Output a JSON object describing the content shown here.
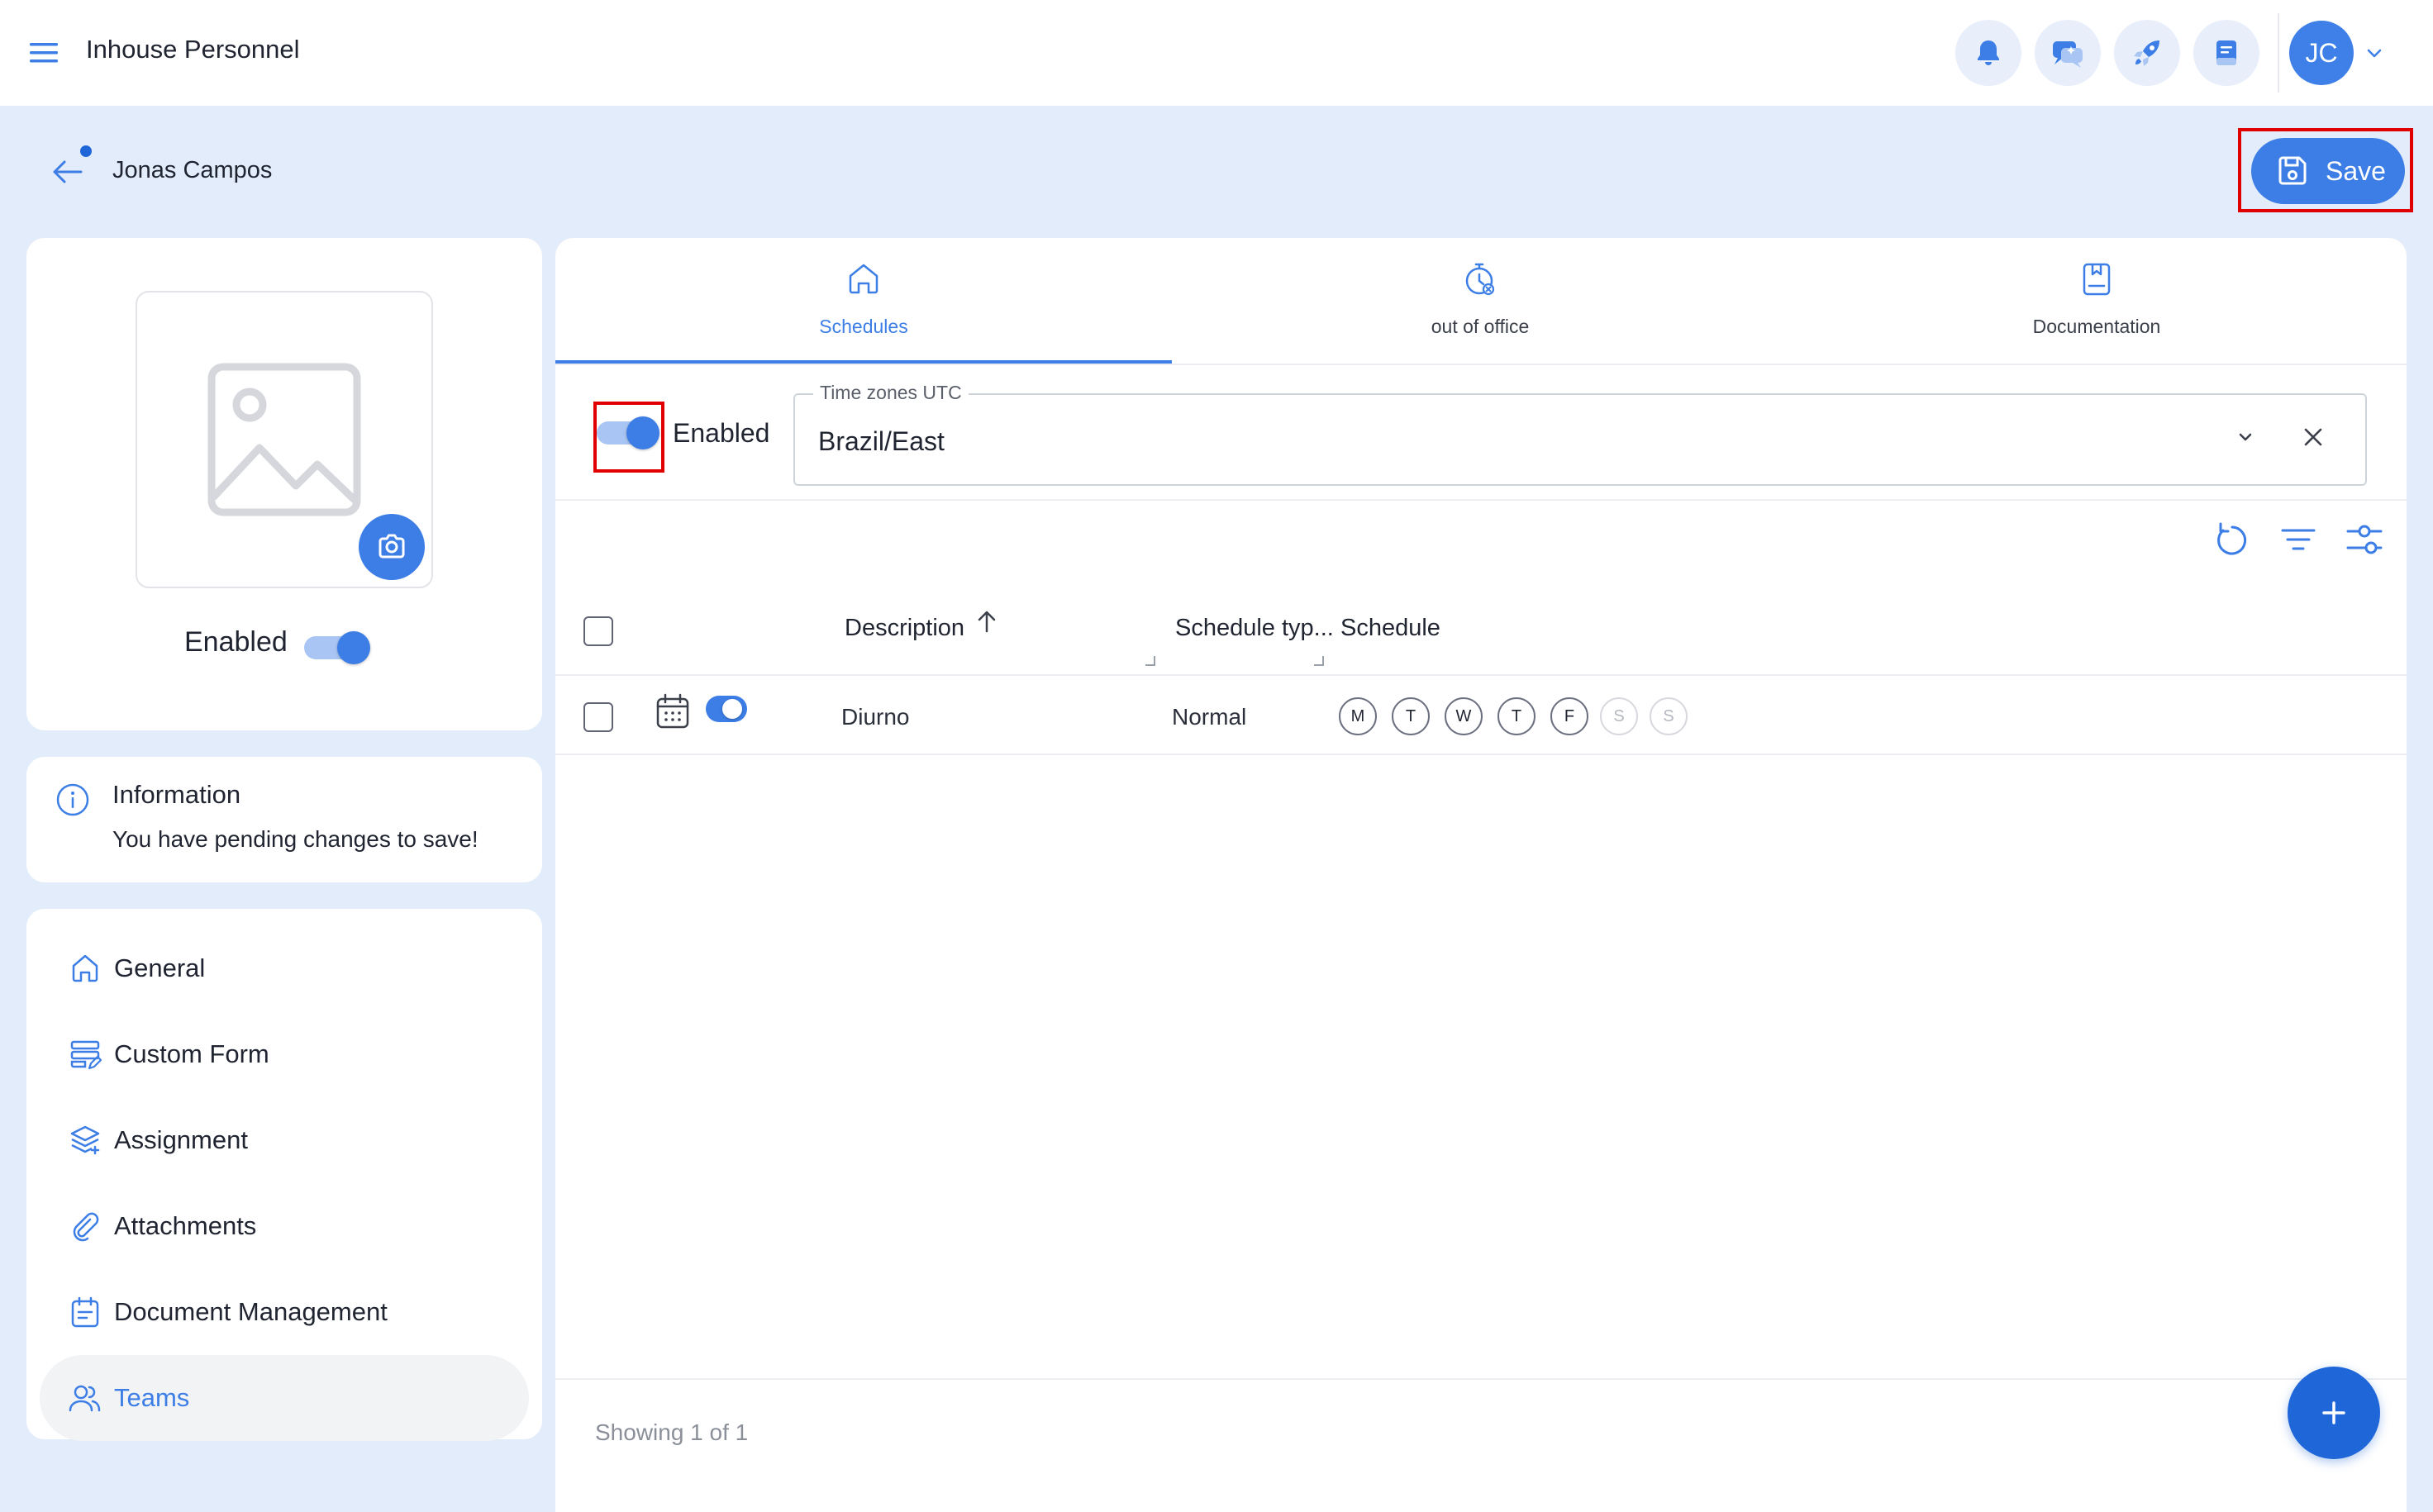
{
  "app": {
    "title": "Inhouse Personnel",
    "avatar_initials": "JC"
  },
  "topbar": {
    "icons": [
      "bell-icon",
      "chat-sparkle-icon",
      "rocket-icon",
      "notes-icon"
    ]
  },
  "header": {
    "person_name": "Jonas Campos",
    "save_label": "Save"
  },
  "profile": {
    "enabled_label": "Enabled",
    "enabled": true
  },
  "info": {
    "title": "Information",
    "message": "You have pending changes to save!"
  },
  "nav": {
    "items": [
      {
        "label": "General",
        "icon": "home-icon",
        "active": false
      },
      {
        "label": "Custom Form",
        "icon": "form-icon",
        "active": false
      },
      {
        "label": "Assignment",
        "icon": "layers-icon",
        "active": false
      },
      {
        "label": "Attachments",
        "icon": "paperclip-icon",
        "active": false
      },
      {
        "label": "Document Management",
        "icon": "calendar-doc-icon",
        "active": false
      },
      {
        "label": "Teams",
        "icon": "users-icon",
        "active": true
      }
    ]
  },
  "tabs": [
    {
      "label": "Schedules",
      "icon": "home-icon",
      "active": true
    },
    {
      "label": "out of office",
      "icon": "timer-icon",
      "active": false
    },
    {
      "label": "Documentation",
      "icon": "bookmark-doc-icon",
      "active": false
    }
  ],
  "schedules": {
    "enabled_label": "Enabled",
    "enabled": true,
    "timezone_legend": "Time zones UTC",
    "timezone_value": "Brazil/East",
    "columns": {
      "description": "Description",
      "schedule_type": "Schedule typ...",
      "schedule": "Schedule"
    },
    "rows": [
      {
        "description": "Diurno",
        "schedule_type": "Normal",
        "enabled": true,
        "days": [
          {
            "label": "M",
            "active": true
          },
          {
            "label": "T",
            "active": true
          },
          {
            "label": "W",
            "active": true
          },
          {
            "label": "T",
            "active": true
          },
          {
            "label": "F",
            "active": true
          },
          {
            "label": "S",
            "active": false
          },
          {
            "label": "S",
            "active": false
          }
        ]
      }
    ],
    "footer": "Showing 1 of 1"
  },
  "colors": {
    "accent": "#3c7ee6",
    "fab": "#1f66d8",
    "background": "#e3ecfb",
    "highlight": "#e00000"
  }
}
